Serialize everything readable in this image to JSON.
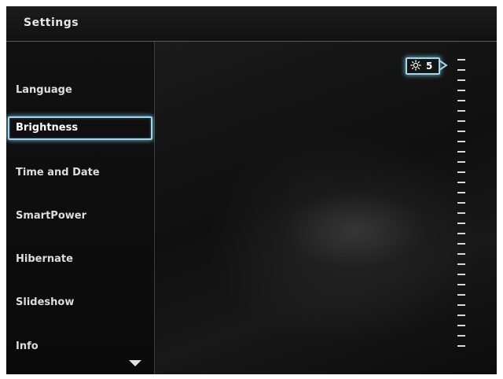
{
  "header": {
    "title": "Settings"
  },
  "menu": {
    "items": [
      {
        "label": "Language"
      },
      {
        "label": "Brightness",
        "selected": true
      },
      {
        "label": "Time and Date"
      },
      {
        "label": "SmartPower"
      },
      {
        "label": "Hibernate"
      },
      {
        "label": "Slideshow"
      },
      {
        "label": "Info"
      }
    ],
    "more_icon": "triangle-down-icon"
  },
  "brightness": {
    "value": "5",
    "icon": "sun-icon",
    "level": 5,
    "levels": 29
  },
  "colors": {
    "highlight": "#9fd6ea",
    "background": "#0d0d0d",
    "text": "#dddddd"
  }
}
